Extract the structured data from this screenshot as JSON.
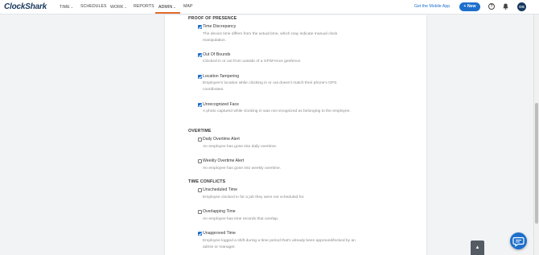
{
  "header": {
    "logo": "ClockShark",
    "nav": [
      {
        "label": "TIME",
        "caret": "⌄"
      },
      {
        "label": "SCHEDULES",
        "caret": ""
      },
      {
        "label": "WORK",
        "caret": "⌄"
      },
      {
        "label": "REPORTS",
        "caret": ""
      },
      {
        "label": "ADMIN",
        "caret": "⌄"
      },
      {
        "label": "MAP",
        "caret": ""
      }
    ],
    "active_tab": "ADMIN",
    "mobile_link": "Get the Mobile App",
    "new_button": "+ New",
    "help_icon": "question-circle-icon",
    "bell_icon": "bell-icon",
    "avatar_initials": "OS",
    "accent_color": "#e26b2b",
    "brand_color": "#1e6fcc"
  },
  "sections": [
    {
      "title": "PROOF OF PRESENCE",
      "options": [
        {
          "label": "Time Discrepancy",
          "checked": true,
          "desc": "The device time differs from the actual time, which may indicate manual clock manipulation."
        },
        {
          "label": "Out Of Bounds",
          "checked": true,
          "desc": "Clocked in or out from outside of a GPSFence geofence."
        },
        {
          "label": "Location Tampering",
          "checked": true,
          "desc": "Employee's location while clocking in or out doesn't match their phone's GPS coordinates."
        },
        {
          "label": "Unrecognized Face",
          "checked": true,
          "desc": "A photo captured while clocking in was not recognized as belonging to the employee."
        }
      ]
    },
    {
      "title": "OVERTIME",
      "options": [
        {
          "label": "Daily Overtime Alert",
          "checked": false,
          "desc": "An employee has gone into daily overtime."
        },
        {
          "label": "Weekly Overtime Alert",
          "checked": false,
          "desc": "An employee has gone into weekly overtime."
        }
      ]
    },
    {
      "title": "TIME CONFLICTS",
      "options": [
        {
          "label": "Unscheduled Time",
          "checked": false,
          "desc": "Employee clocked in for a job they were not scheduled for."
        },
        {
          "label": "Overlapping Time",
          "checked": false,
          "desc": "An employee has time records that overlap."
        },
        {
          "label": "Unapproved Time",
          "checked": true,
          "desc": "Employee logged a shift during a time period that's already been approved/locked by an admin or manager."
        }
      ]
    }
  ],
  "floating": {
    "scroll_top_icon": "chevron-up-icon",
    "scroll_top_glyph": "▲",
    "chat_icon": "chat-bubble-icon"
  }
}
